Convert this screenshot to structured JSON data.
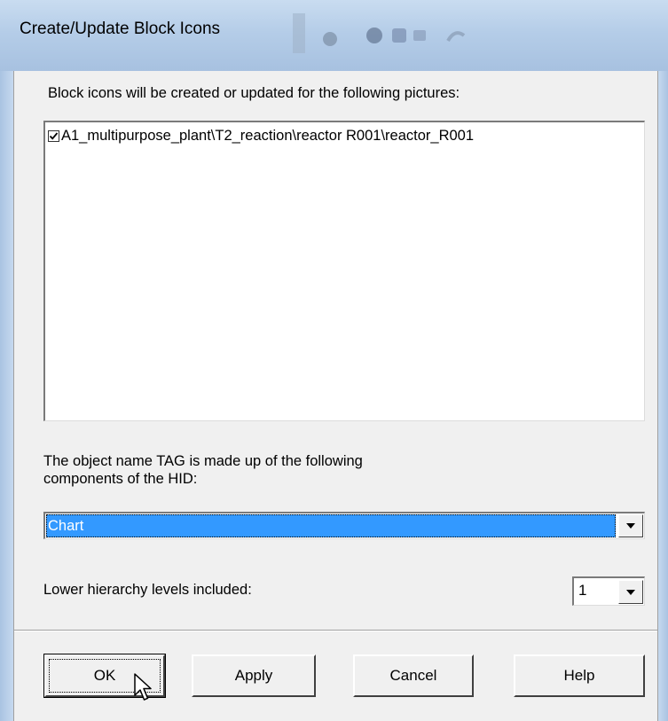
{
  "window": {
    "title": "Create/Update Block Icons"
  },
  "dialog": {
    "intro_text": "Block icons will be created or updated for the following pictures:",
    "pictures": [
      {
        "label": "A1_multipurpose_plant\\T2_reaction\\reactor R001\\reactor_R001",
        "checked": true
      }
    ],
    "tag_text_line1": "The object name TAG is made up of the following",
    "tag_text_line2": "components of the HID:",
    "tag_combo": {
      "selected": "Chart"
    },
    "hierarchy_label": "Lower hierarchy levels included:",
    "hierarchy_combo": {
      "selected": "1"
    },
    "buttons": {
      "ok": "OK",
      "apply": "Apply",
      "cancel": "Cancel",
      "help": "Help"
    }
  },
  "icons": {
    "checkbox": "checkmark-icon",
    "dropdown": "chevron-down-icon",
    "cursor": "mouse-pointer-icon"
  },
  "colors": {
    "selection": "#3399ff",
    "dialog_bg": "#f0f0f0",
    "titlebar": "#b5cde8"
  }
}
